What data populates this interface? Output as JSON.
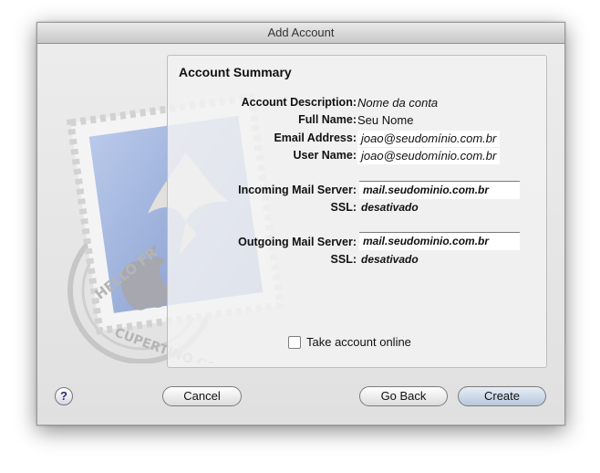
{
  "window": {
    "title": "Add Account"
  },
  "stamp": {
    "text_top": "HELLO FR",
    "text_bottom": "CUPERTINO CA"
  },
  "summary": {
    "title": "Account Summary",
    "fields": [
      {
        "label": "Account Description:",
        "value": "Nome da conta"
      },
      {
        "label": "Full Name:",
        "value": "Seu Nome"
      },
      {
        "label": "Email Address:",
        "value": "joao@seudomínio.com.br"
      },
      {
        "label": "User Name:",
        "value": "joao@seudomínio.com.br"
      }
    ],
    "incoming": {
      "label": "Incoming Mail Server:",
      "value": "mail.seudominio.com.br",
      "ssl_label": "SSL:",
      "ssl_value": "desativado"
    },
    "outgoing": {
      "label": "Outgoing Mail Server:",
      "value": "mail.seudominio.com.br",
      "ssl_label": "SSL:",
      "ssl_value": "desativado"
    },
    "online": {
      "label": "Take account online",
      "checked": false
    }
  },
  "buttons": {
    "help": "?",
    "cancel": "Cancel",
    "back": "Go Back",
    "create": "Create"
  }
}
